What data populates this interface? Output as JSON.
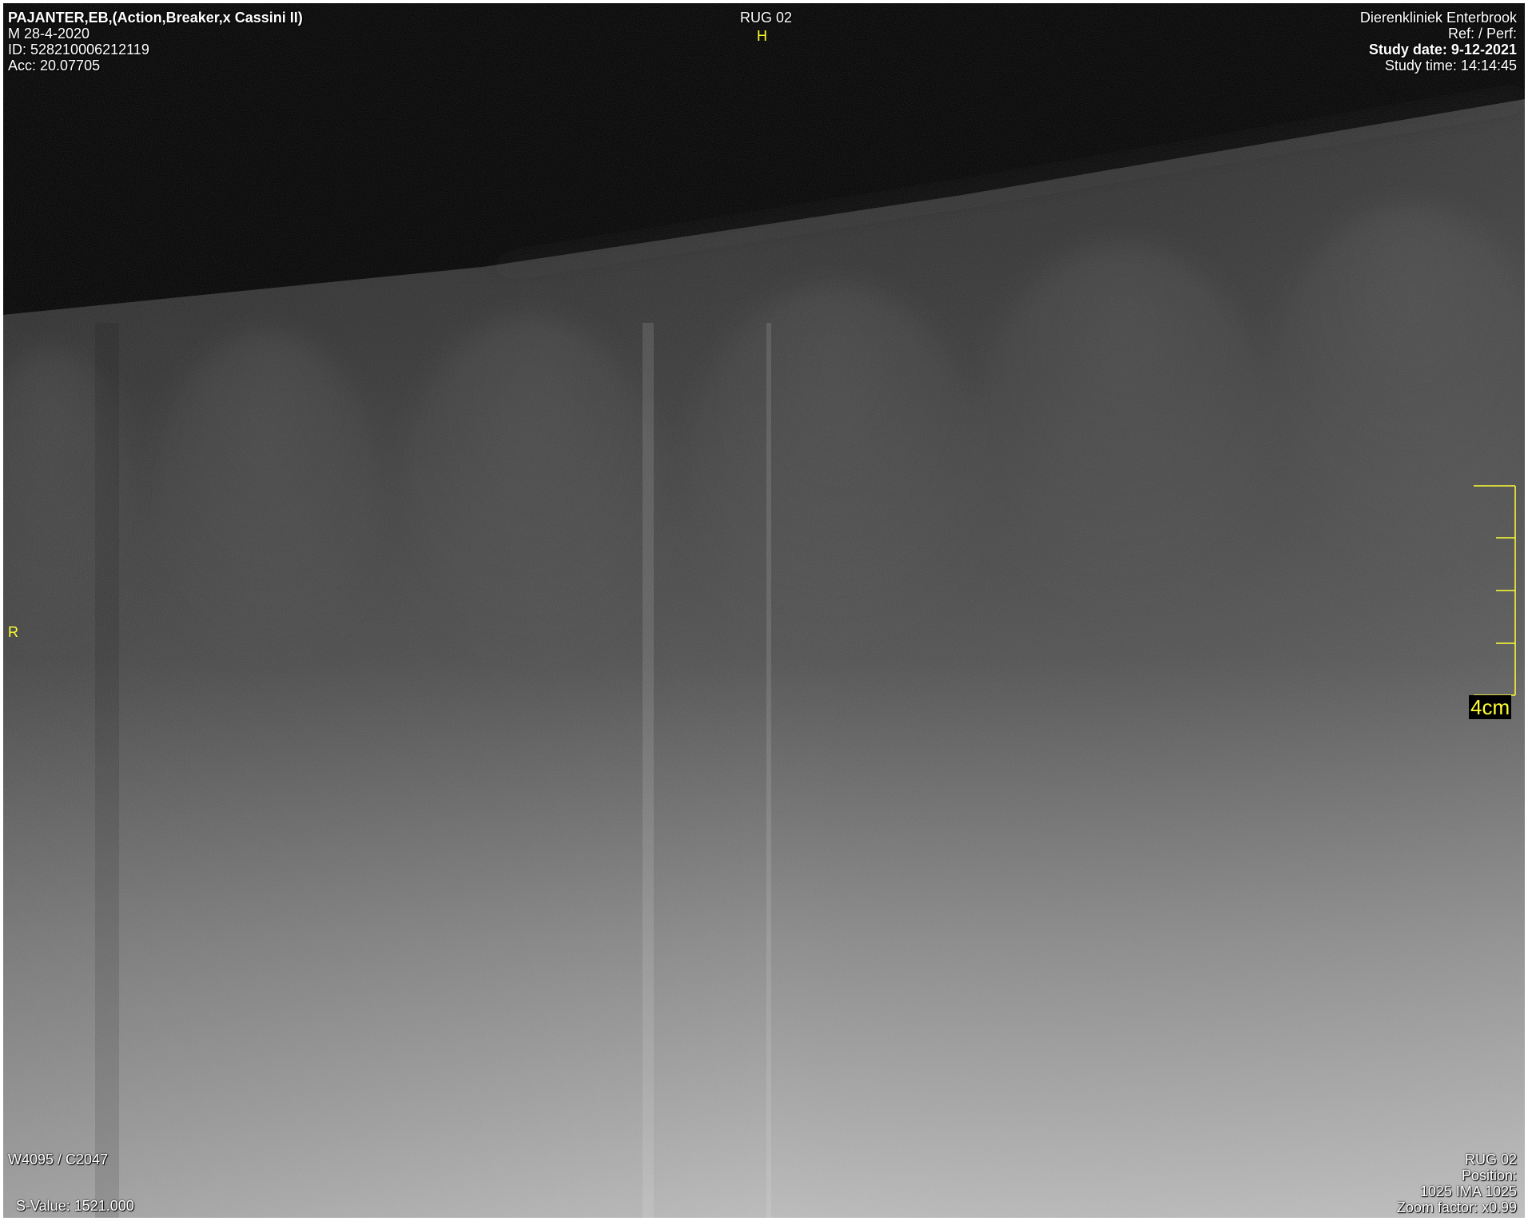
{
  "patient": {
    "name_line": "PAJANTER,EB,(Action,Breaker,x Cassini II)",
    "sex_dob": "M  28-4-2020",
    "id_line": "ID: 528210006212119",
    "acc_line": "Acc: 20.07705"
  },
  "series": {
    "title": "RUG 02",
    "orientation_top": "H",
    "orientation_left": "R"
  },
  "institution": {
    "name": "Dierenkliniek Enterbrook",
    "ref_perf": "Ref:  / Perf:",
    "study_date": "Study date: 9-12-2021",
    "study_time": "Study time: 14:14:45"
  },
  "window": {
    "wl": "W4095 / C2047",
    "s_value": "S-Value: 1521.000"
  },
  "image_info": {
    "series_name": "RUG 02",
    "position_label": "Position:",
    "image_index": "1025 IMA 1025",
    "zoom": "Zoom factor: x0.99"
  },
  "scale": {
    "label": "4cm"
  },
  "colors": {
    "overlay_text": "#ffffff",
    "annotation": "#ffff33",
    "background": "#000000"
  }
}
